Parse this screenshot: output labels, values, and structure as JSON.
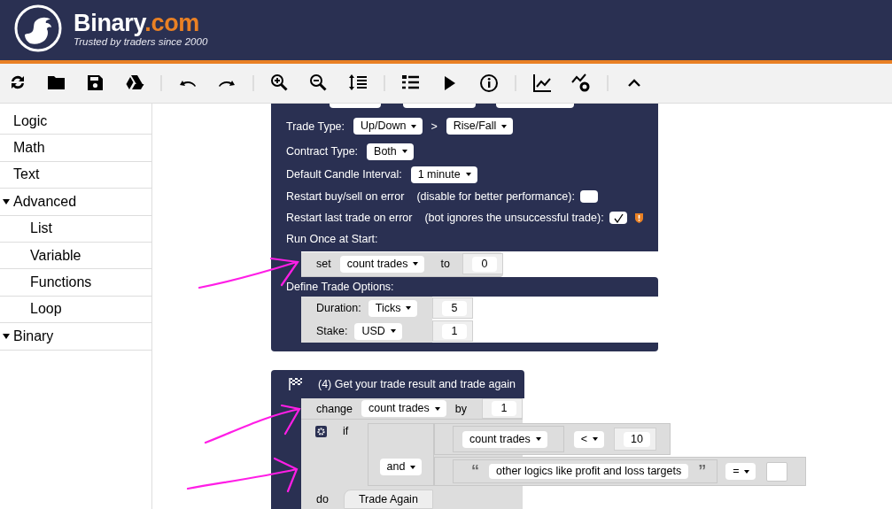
{
  "header": {
    "brand": "Binary",
    "brand_suffix": ".com",
    "tagline": "Trusted by traders since 2000"
  },
  "sidebar": {
    "items": [
      {
        "label": "Logic"
      },
      {
        "label": "Math"
      },
      {
        "label": "Text"
      },
      {
        "label": "Advanced",
        "expanded": true,
        "children": [
          {
            "label": "List"
          },
          {
            "label": "Variable"
          },
          {
            "label": "Functions"
          },
          {
            "label": "Loop"
          }
        ]
      },
      {
        "label": "Binary",
        "expanded": true
      }
    ]
  },
  "trade_block": {
    "rows": [
      {
        "kind": "fields",
        "label": "Trade Type:",
        "items": [
          {
            "kind": "dropdown",
            "text": "Up/Down"
          },
          {
            "kind": "label",
            "text": ">"
          },
          {
            "kind": "dropdown",
            "text": "Rise/Fall"
          }
        ]
      },
      {
        "kind": "fields",
        "label": "Contract Type:",
        "items": [
          {
            "kind": "dropdown",
            "text": "Both"
          }
        ]
      },
      {
        "kind": "fields",
        "label": "Default Candle Interval:",
        "items": [
          {
            "kind": "dropdown",
            "text": "1 minute"
          }
        ]
      },
      {
        "kind": "checkbox",
        "label": "Restart buy/sell on error",
        "note": "(disable for better performance):",
        "checked": false,
        "warning": false
      },
      {
        "kind": "checkbox",
        "label": "Restart last trade on error",
        "note": "(bot ignores the unsuccessful trade):",
        "checked": true,
        "warning": true
      }
    ],
    "run_once": {
      "label": "Run Once at Start:",
      "keyword": "set",
      "variable": "count trades",
      "to": "to",
      "value": "0"
    },
    "trade_options": {
      "label": "Define Trade Options:",
      "rows": [
        {
          "label": "Duration:",
          "dropdown": "Ticks",
          "value": "5"
        },
        {
          "label": "Stake:",
          "dropdown": "USD",
          "value": "1"
        }
      ]
    }
  },
  "result_block": {
    "title": "(4) Get your trade result and trade again",
    "change": {
      "keyword": "change",
      "variable": "count trades",
      "by": "by",
      "value": "1"
    },
    "if": {
      "keyword": "if",
      "compare": {
        "variable": "count trades",
        "operator": "<",
        "value": "10"
      },
      "joiner": "and",
      "text_compare": {
        "open_quote": "“",
        "text": "other logics like profit and loss targets",
        "close_quote": "”",
        "operator": "="
      },
      "do": "do",
      "action": "Trade Again"
    }
  },
  "annotations": [
    {
      "kind": "arrow"
    },
    {
      "kind": "arrow"
    },
    {
      "kind": "arrow"
    }
  ]
}
